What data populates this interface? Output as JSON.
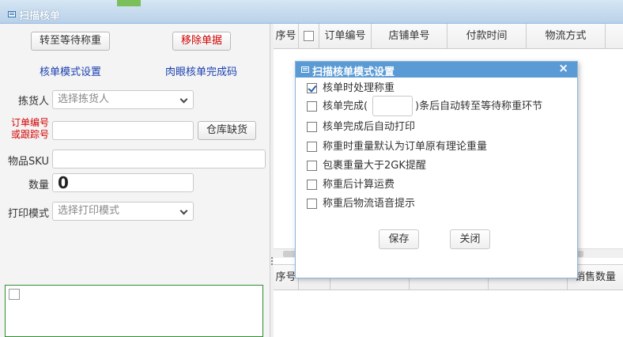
{
  "window": {
    "title": "扫描核单"
  },
  "left": {
    "btn_transfer": "转至等待称重",
    "btn_remove": "移除单据",
    "link_mode_settings": "核单模式设置",
    "link_visual_code": "肉眼核单完成码",
    "picker_label": "拣货人",
    "picker_placeholder": "选择拣货人",
    "order_label_line1": "订单编号",
    "order_label_line2": "或跟踪号",
    "btn_stockout": "仓库缺货",
    "sku_label": "物品SKU",
    "qty_label": "数量",
    "qty_value": "0",
    "print_mode_label": "打印模式",
    "print_mode_placeholder": "选择打印模式"
  },
  "grid_top": {
    "columns": [
      "序号",
      "",
      "订单编号",
      "店铺单号",
      "付款时间",
      "物流方式"
    ]
  },
  "grid_bottom": {
    "columns": [
      "序号",
      "",
      "",
      "",
      "",
      "销售数量"
    ]
  },
  "dialog": {
    "title": "扫描核单模式设置",
    "close_glyph": "×",
    "options": [
      {
        "label": "核单时处理称重",
        "checked": true
      },
      {
        "label_before": "核单完成(",
        "label_after": ")条后自动转至等待称重环节",
        "checked": false
      },
      {
        "label": "核单完成后自动打印",
        "checked": false
      },
      {
        "label": "称重时重量默认为订单原有理论重量",
        "checked": false
      },
      {
        "label": "包裹重量大于2GK提醒",
        "checked": false
      },
      {
        "label": "称重后计算运费",
        "checked": false
      },
      {
        "label": "称重后物流语音提示",
        "checked": false
      }
    ],
    "save_label": "保存",
    "close_label": "关闭"
  },
  "colors": {
    "dialog_title_bg": "#5b9bd5",
    "link": "#1a3fb0",
    "danger": "#d40000",
    "title_bar": "#b9d1e8"
  }
}
